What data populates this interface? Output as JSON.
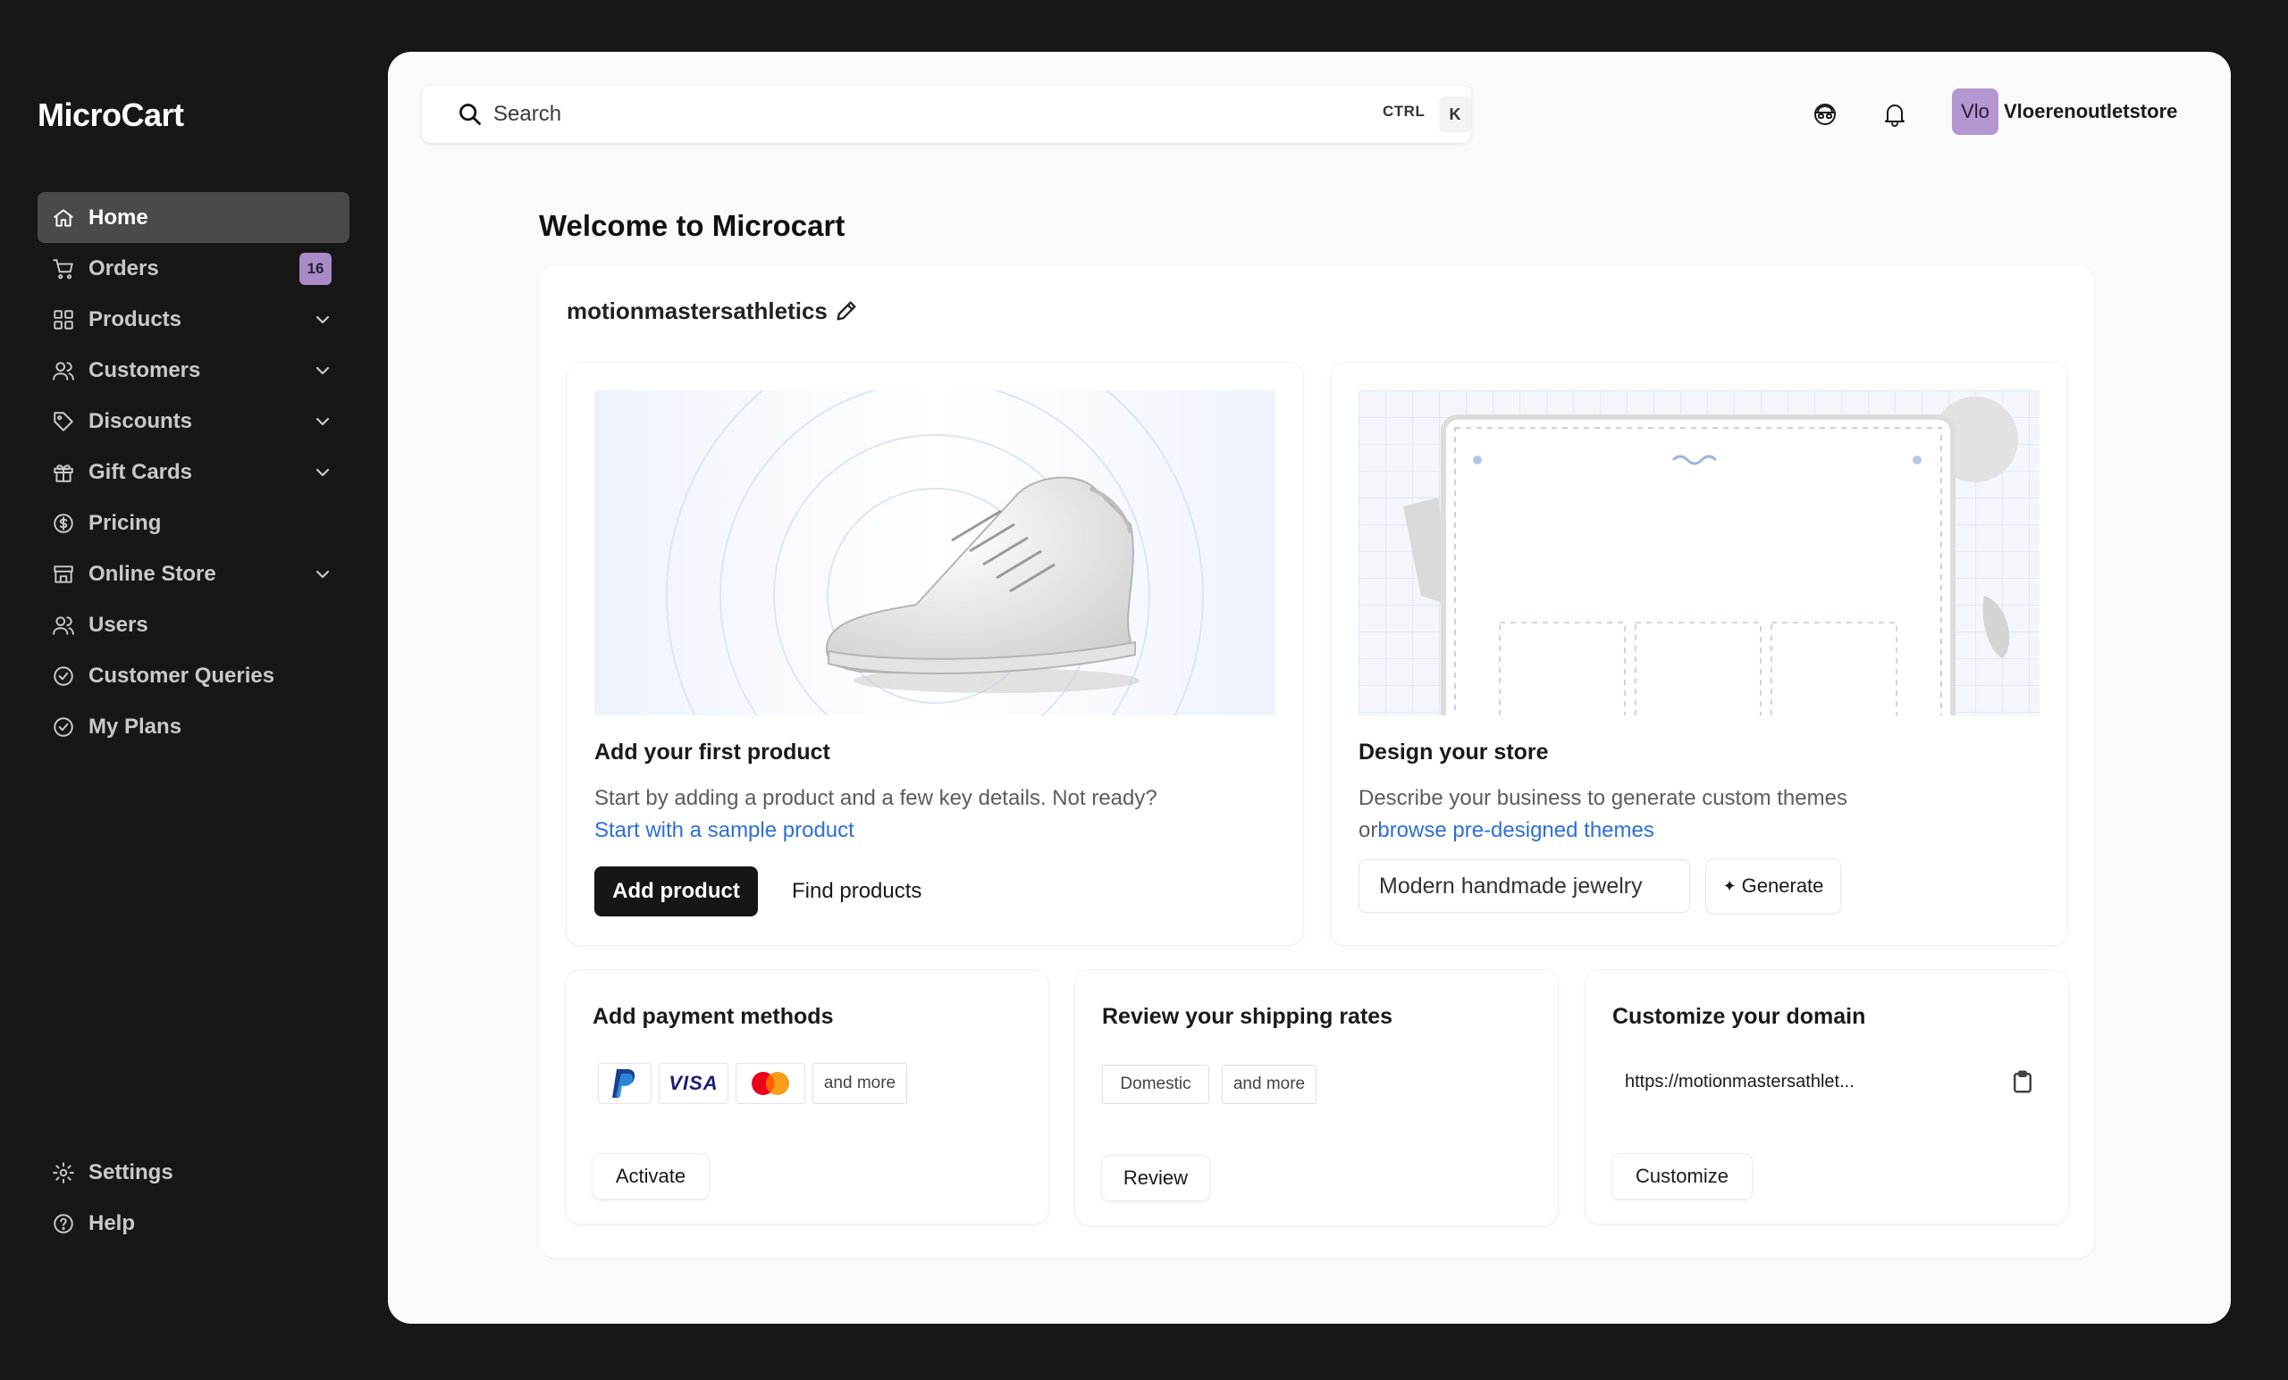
{
  "brand": "MicroCart",
  "nav": {
    "items": [
      {
        "label": "Home"
      },
      {
        "label": "Orders",
        "badge": "16"
      },
      {
        "label": "Products"
      },
      {
        "label": "Customers"
      },
      {
        "label": "Discounts"
      },
      {
        "label": "Gift Cards"
      },
      {
        "label": "Pricing"
      },
      {
        "label": "Online Store"
      },
      {
        "label": "Users"
      },
      {
        "label": "Customer Queries"
      },
      {
        "label": "My Plans"
      }
    ],
    "bottom": [
      {
        "label": "Settings"
      },
      {
        "label": "Help"
      }
    ]
  },
  "header": {
    "search_placeholder": "Search",
    "shortcut_ctrl": "CTRL",
    "shortcut_key": "K",
    "avatar_initials": "Vlo",
    "store_user": "Vloerenoutletstore"
  },
  "main": {
    "welcome": "Welcome to Microcart",
    "store_name": "motionmastersathletics",
    "product_card": {
      "title": "Add your first product",
      "desc_prefix": "Start by adding a product and a few key details. Not ready?",
      "desc_link": "Start with a sample product",
      "primary_button": "Add product",
      "secondary_button": "Find products"
    },
    "design_card": {
      "title": "Design your store",
      "desc_prefix": "Describe your business to generate custom themes or",
      "desc_link": "browse pre-designed themes",
      "input_value": "Modern handmade jewelry",
      "generate_button": "Generate"
    },
    "payment_card": {
      "title": "Add payment methods",
      "logo_visa": "VISA",
      "more": "and more",
      "button": "Activate"
    },
    "shipping_card": {
      "title": "Review your shipping rates",
      "chip1": "Domestic",
      "chip2": "and more",
      "button": "Review"
    },
    "domain_card": {
      "title": "Customize your domain",
      "url": "https://motionmastersathlet...",
      "button": "Customize"
    }
  },
  "colors": {
    "sidebar_bg": "#171717",
    "active_nav": "#4a4a4a",
    "badge": "#a98bc7",
    "link": "#2d6fd6",
    "primary_button": "#161616"
  }
}
